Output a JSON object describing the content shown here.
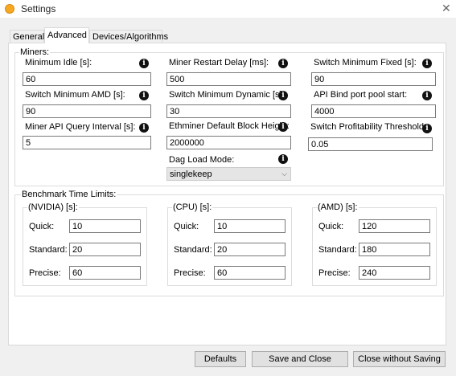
{
  "window": {
    "title": "Settings",
    "close_glyph": "✕",
    "icon": "app-settings-icon"
  },
  "tabs": [
    {
      "label": "General"
    },
    {
      "label": "Advanced",
      "active": true
    },
    {
      "label": "Devices/Algorithms"
    }
  ],
  "miners": {
    "legend": "Miners:",
    "info_glyph": "i",
    "fields": {
      "minimum_idle": {
        "label": "Minimum Idle [s]:",
        "value": "60"
      },
      "miner_restart_delay": {
        "label": "Miner Restart Delay [ms]:",
        "value": "500"
      },
      "switch_minimum_fixed": {
        "label": "Switch Minimum Fixed [s]:",
        "value": "90"
      },
      "switch_minimum_amd": {
        "label": "Switch Minimum AMD [s]:",
        "value": "90"
      },
      "switch_minimum_dynamic": {
        "label": "Switch Minimum Dynamic [s]:",
        "value": "30"
      },
      "api_bind_port": {
        "label": "API Bind port pool start:",
        "value": "4000"
      },
      "miner_api_query_interval": {
        "label": "Miner API Query Interval [s]:",
        "value": "5"
      },
      "ethminer_block_height": {
        "label": "Ethminer Default Block Height:",
        "value": "2000000"
      },
      "switch_profitability_threshold": {
        "label": "Switch Profitability Threshold",
        "value": "0.05"
      },
      "dag_load_mode": {
        "label": "Dag Load Mode:",
        "value": "singlekeep",
        "arrow": "⌵"
      }
    }
  },
  "benchmark": {
    "legend": "Benchmark Time Limits:",
    "groups": [
      {
        "title": "(NVIDIA) [s]:",
        "quick_label": "Quick:",
        "quick": "10",
        "standard_label": "Standard:",
        "standard": "20",
        "precise_label": "Precise:",
        "precise": "60"
      },
      {
        "title": "(CPU) [s]:",
        "quick_label": "Quick:",
        "quick": "10",
        "standard_label": "Standard:",
        "standard": "20",
        "precise_label": "Precise:",
        "precise": "60"
      },
      {
        "title": "(AMD) [s]:",
        "quick_label": "Quick:",
        "quick": "120",
        "standard_label": "Standard:",
        "standard": "180",
        "precise_label": "Precise:",
        "precise": "240"
      }
    ]
  },
  "buttons": {
    "defaults": "Defaults",
    "save_and_close": "Save and Close",
    "close_without_saving": "Close without Saving"
  }
}
